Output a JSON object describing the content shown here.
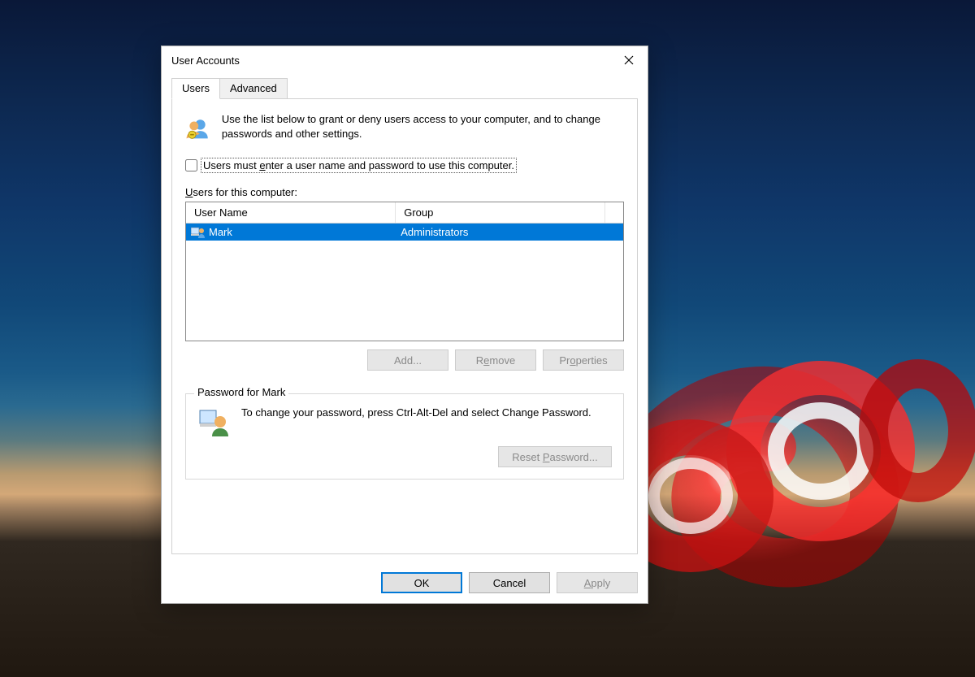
{
  "window": {
    "title": "User Accounts"
  },
  "tabs": {
    "users": "Users",
    "advanced": "Advanced"
  },
  "intro_text": "Use the list below to grant or deny users access to your computer, and to change passwords and other settings.",
  "checkbox": {
    "label_pre": "Users must ",
    "label_u": "e",
    "label_post": "nter a user name and password to use this computer."
  },
  "users_label_pre": "U",
  "users_label_post": "sers for this computer:",
  "columns": {
    "user": "User Name",
    "group": "Group"
  },
  "rows": [
    {
      "name": "Mark",
      "group": "Administrators"
    }
  ],
  "btn": {
    "add": "Add...",
    "remove_pre": "R",
    "remove_u": "e",
    "remove_post": "move",
    "props_pre": "Pr",
    "props_u": "o",
    "props_post": "perties",
    "reset_pre": "Reset ",
    "reset_u": "P",
    "reset_post": "assword...",
    "ok": "OK",
    "cancel": "Cancel",
    "apply_u": "A",
    "apply_post": "pply"
  },
  "password_group": {
    "title": "Password for Mark",
    "text": "To change your password, press Ctrl-Alt-Del and select Change Password."
  }
}
